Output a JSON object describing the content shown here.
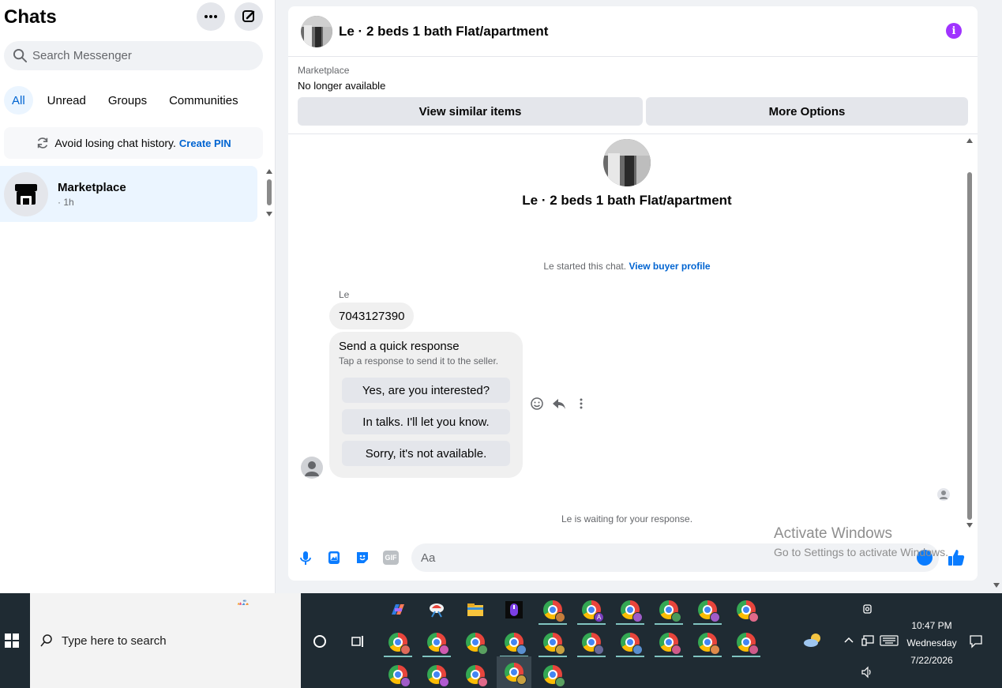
{
  "sidebar": {
    "title": "Chats",
    "search_placeholder": "Search Messenger",
    "filters": [
      "All",
      "Unread",
      "Groups",
      "Communities"
    ],
    "pin_banner": {
      "text": "Avoid losing chat history.",
      "link": "Create PIN"
    },
    "chats": [
      {
        "name": "Marketplace",
        "time": "· 1h"
      }
    ]
  },
  "header": {
    "title": "Le · 2 beds 1 bath Flat/apartment"
  },
  "marketplace": {
    "label": "Marketplace",
    "status": "No longer available",
    "view_similar": "View similar items",
    "more_options": "More Options"
  },
  "thread": {
    "title": "Le · 2 beds 1 bath Flat/apartment",
    "started_text": "Le started this chat.",
    "started_link": "View buyer profile",
    "sender": "Le",
    "message": "7043127390",
    "quick_title": "Send a quick response",
    "quick_sub": "Tap a response to send it to the seller.",
    "quick_responses": [
      "Yes, are you interested?",
      "In talks. I'll let you know.",
      "Sorry, it's not available."
    ],
    "waiting": "Le is waiting for your response."
  },
  "composer": {
    "placeholder": "Aa",
    "gif_label": "GIF"
  },
  "watermark": {
    "line1": "Activate Windows",
    "line2": "Go to Settings to activate Windows."
  },
  "taskbar": {
    "search_placeholder": "Type here to search",
    "time": "10:47 PM",
    "day": "Wednesday",
    "date": "7/22/2026",
    "profile_letter": "A"
  },
  "colors": {
    "accent": "#0064d1",
    "info": "#a033ff",
    "selected_bg": "#ebf5ff",
    "taskbar_bg": "#1f2b33"
  }
}
